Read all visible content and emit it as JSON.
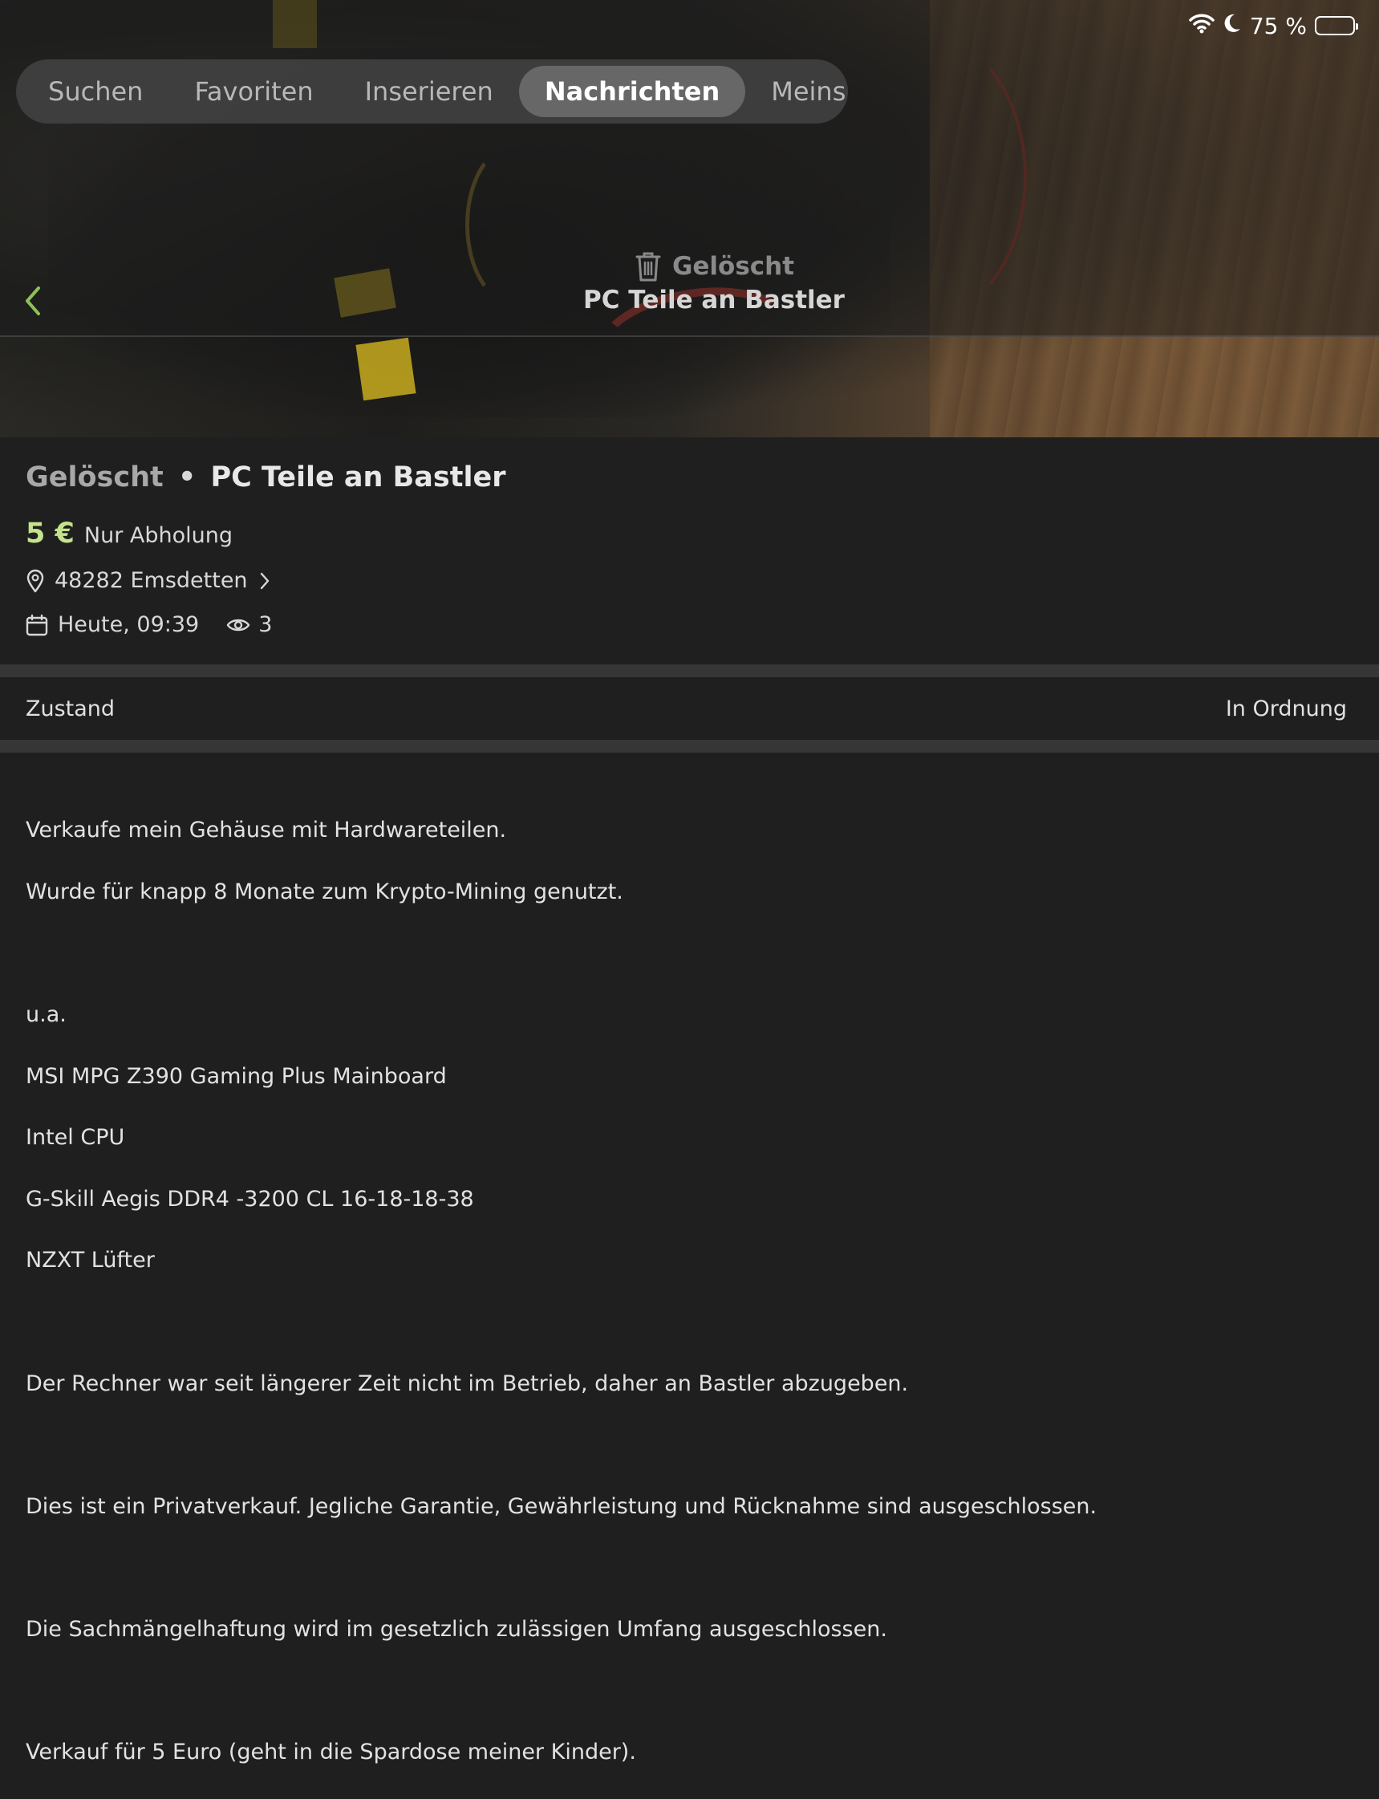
{
  "status_bar": {
    "battery_text": "75 %",
    "battery_level": 0.72
  },
  "tabs": [
    {
      "label": "Suchen",
      "active": false
    },
    {
      "label": "Favoriten",
      "active": false
    },
    {
      "label": "Inserieren",
      "active": false
    },
    {
      "label": "Nachrichten",
      "active": true
    },
    {
      "label": "Meins",
      "active": false
    }
  ],
  "header": {
    "status": "Gelöscht",
    "title": "PC Teile an Bastler"
  },
  "listing": {
    "status": "Gelöscht",
    "separator": "•",
    "title": "PC Teile an Bastler",
    "price": "5 €",
    "shipping": "Nur Abholung",
    "location": "48282 Emsdetten",
    "date": "Heute, 09:39",
    "views": "3"
  },
  "details": {
    "label": "Zustand",
    "value": "In Ordnung"
  },
  "description": [
    "Verkaufe mein Gehäuse mit Hardwareteilen.",
    "Wurde für knapp 8 Monate zum Krypto-Mining genutzt.",
    "",
    "u.a.",
    "MSI MPG Z390 Gaming Plus Mainboard",
    "Intel CPU",
    "G-Skill Aegis DDR4 -3200 CL 16-18-18-38",
    "NZXT Lüfter",
    "",
    "Der Rechner war seit längerer Zeit nicht im Betrieb, daher an Bastler abzugeben.",
    "",
    "Dies ist ein Privatverkauf. Jegliche Garantie, Gewährleistung und Rücknahme sind ausgeschlossen.",
    "",
    "Die Sachmängelhaftung wird im gesetzlich zulässigen Umfang ausgeschlossen.",
    "",
    "Verkauf für 5 Euro (geht in die Spardose meiner Kinder)."
  ],
  "colors": {
    "accent_green": "#8fbf5a",
    "price_green": "#c5e38c",
    "background": "#1f1f1f"
  },
  "icons": [
    "wifi-icon",
    "moon-icon",
    "battery-icon",
    "back-chevron-icon",
    "trash-icon",
    "location-pin-icon",
    "chevron-right-icon",
    "calendar-icon",
    "eye-icon"
  ]
}
